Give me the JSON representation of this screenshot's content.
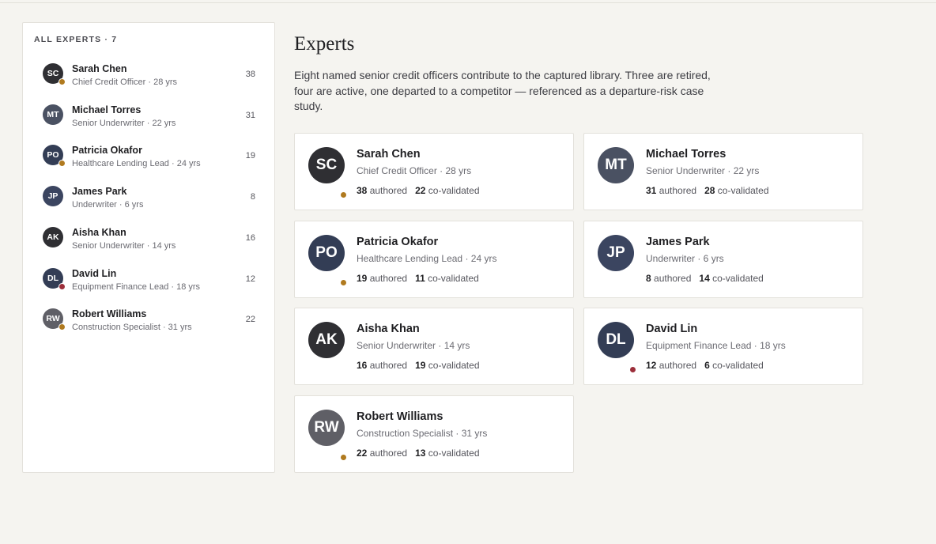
{
  "sidebar": {
    "heading": "ALL EXPERTS · 7",
    "items": [
      {
        "initials": "SC",
        "name": "Sarah Chen",
        "role": "Chief Credit Officer · 28 yrs",
        "count": "38",
        "avatar_color": "#2f2f33",
        "status_color": "#b07a1f"
      },
      {
        "initials": "MT",
        "name": "Michael Torres",
        "role": "Senior Underwriter · 22 yrs",
        "count": "31",
        "avatar_color": "#4a5162",
        "status_color": ""
      },
      {
        "initials": "PO",
        "name": "Patricia Okafor",
        "role": "Healthcare Lending Lead · 24 yrs",
        "count": "19",
        "avatar_color": "#333d55",
        "status_color": "#b07a1f"
      },
      {
        "initials": "JP",
        "name": "James Park",
        "role": "Underwriter · 6 yrs",
        "count": "8",
        "avatar_color": "#3b4560",
        "status_color": ""
      },
      {
        "initials": "AK",
        "name": "Aisha Khan",
        "role": "Senior Underwriter · 14 yrs",
        "count": "16",
        "avatar_color": "#2f2f33",
        "status_color": ""
      },
      {
        "initials": "DL",
        "name": "David Lin",
        "role": "Equipment Finance Lead · 18 yrs",
        "count": "12",
        "avatar_color": "#333d55",
        "status_color": "#9c2e3a"
      },
      {
        "initials": "RW",
        "name": "Robert Williams",
        "role": "Construction Specialist · 31 yrs",
        "count": "22",
        "avatar_color": "#5f5f66",
        "status_color": "#b07a1f"
      }
    ]
  },
  "main": {
    "title": "Experts",
    "description": "Eight named senior credit officers contribute to the captured library. Three are retired, four are active, one departed to a competitor — referenced as a departure-risk case study.",
    "authored_label": "authored",
    "covalidated_label": "co-validated",
    "cards": [
      {
        "initials": "SC",
        "name": "Sarah Chen",
        "role": "Chief Credit Officer · 28 yrs",
        "authored": "38",
        "covalidated": "22",
        "avatar_color": "#2f2f33",
        "status_color": "#b07a1f"
      },
      {
        "initials": "MT",
        "name": "Michael Torres",
        "role": "Senior Underwriter · 22 yrs",
        "authored": "31",
        "covalidated": "28",
        "avatar_color": "#4a5162",
        "status_color": ""
      },
      {
        "initials": "PO",
        "name": "Patricia Okafor",
        "role": "Healthcare Lending Lead · 24 yrs",
        "authored": "19",
        "covalidated": "11",
        "avatar_color": "#333d55",
        "status_color": "#b07a1f"
      },
      {
        "initials": "JP",
        "name": "James Park",
        "role": "Underwriter · 6 yrs",
        "authored": "8",
        "covalidated": "14",
        "avatar_color": "#3b4560",
        "status_color": ""
      },
      {
        "initials": "AK",
        "name": "Aisha Khan",
        "role": "Senior Underwriter · 14 yrs",
        "authored": "16",
        "covalidated": "19",
        "avatar_color": "#2f2f33",
        "status_color": ""
      },
      {
        "initials": "DL",
        "name": "David Lin",
        "role": "Equipment Finance Lead · 18 yrs",
        "authored": "12",
        "covalidated": "6",
        "avatar_color": "#333d55",
        "status_color": "#9c2e3a"
      },
      {
        "initials": "RW",
        "name": "Robert Williams",
        "role": "Construction Specialist · 31 yrs",
        "authored": "22",
        "covalidated": "13",
        "avatar_color": "#5f5f66",
        "status_color": "#b07a1f"
      }
    ]
  }
}
